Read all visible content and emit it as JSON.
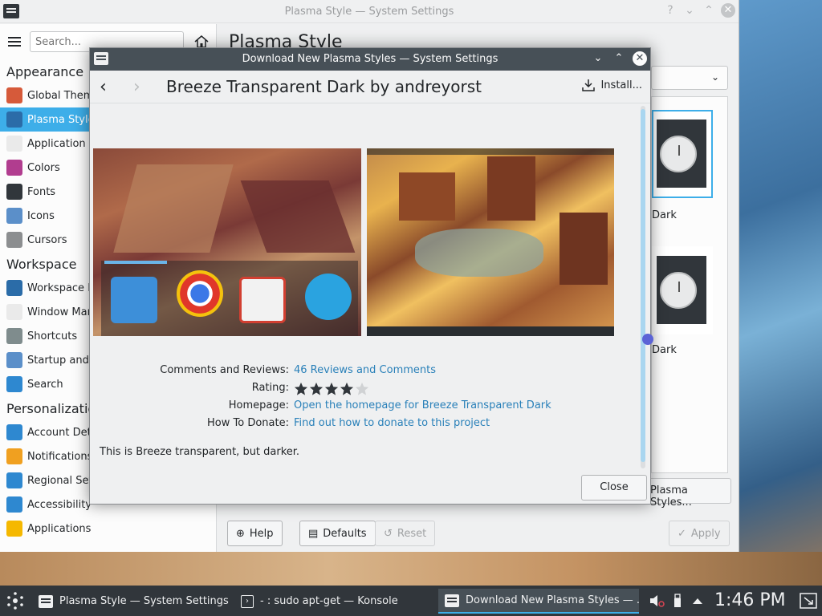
{
  "main_window": {
    "title": "Plasma Style — System Settings",
    "search_placeholder": "Search...",
    "page_title": "Plasma Style",
    "sidebar": {
      "sections": [
        {
          "title": "Appearance",
          "items": [
            {
              "label": "Global Theme",
              "icon": "global-theme-icon",
              "color": "#d65a3a"
            },
            {
              "label": "Plasma Style",
              "icon": "plasma-style-icon",
              "color": "#2b6ca8",
              "selected": true
            },
            {
              "label": "Application Style",
              "icon": "application-style-icon",
              "color": "#eaeaea"
            },
            {
              "label": "Colors",
              "icon": "colors-icon",
              "color": "#b13d8f"
            },
            {
              "label": "Fonts",
              "icon": "fonts-icon",
              "color": "#31363b"
            },
            {
              "label": "Icons",
              "icon": "icons-icon",
              "color": "#5b8fc9"
            },
            {
              "label": "Cursors",
              "icon": "cursors-icon",
              "color": "#8c8e90"
            }
          ]
        },
        {
          "title": "Workspace",
          "items": [
            {
              "label": "Workspace Behavior",
              "icon": "workspace-behavior-icon",
              "color": "#2b6ca8"
            },
            {
              "label": "Window Management",
              "icon": "window-management-icon",
              "color": "#eaeaea"
            },
            {
              "label": "Shortcuts",
              "icon": "shortcuts-icon",
              "color": "#7f8c8d"
            },
            {
              "label": "Startup and Shutdown",
              "icon": "startup-shutdown-icon",
              "color": "#5b8fc9"
            },
            {
              "label": "Search",
              "icon": "search-icon",
              "color": "#2e88d0"
            }
          ]
        },
        {
          "title": "Personalization",
          "items": [
            {
              "label": "Account Details",
              "icon": "account-details-icon",
              "color": "#2e88d0"
            },
            {
              "label": "Notifications",
              "icon": "notifications-icon",
              "color": "#f0a020"
            },
            {
              "label": "Regional Settings",
              "icon": "regional-settings-icon",
              "color": "#2e88d0"
            },
            {
              "label": "Accessibility",
              "icon": "accessibility-icon",
              "color": "#2e88d0"
            },
            {
              "label": "Applications",
              "icon": "applications-icon",
              "color": "#f5b800"
            }
          ]
        }
      ]
    },
    "themes": [
      {
        "name": "Dark",
        "selected": true
      },
      {
        "name": "Dark",
        "selected": false
      }
    ],
    "get_new_label": "Plasma Styles...",
    "buttons": {
      "help": "Help",
      "defaults": "Defaults",
      "reset": "Reset",
      "apply": "Apply"
    }
  },
  "dialog": {
    "title": "Download New Plasma Styles — System Settings",
    "heading": "Breeze Transparent Dark by andreyorst",
    "install_label": "Install...",
    "details": {
      "comments_label": "Comments and Reviews:",
      "comments_value": "46 Reviews and Comments",
      "rating_label": "Rating:",
      "rating_stars": 4,
      "rating_max": 5,
      "homepage_label": "Homepage:",
      "homepage_value": "Open the homepage for Breeze Transparent Dark",
      "donate_label": "How To Donate:",
      "donate_value": "Find out how to donate to this project"
    },
    "description": "This is Breeze transparent, but darker.",
    "close_label": "Close"
  },
  "taskbar": {
    "tasks": [
      {
        "label": "Plasma Style  — System Settings"
      },
      {
        "label": "- : sudo apt-get — Konsole"
      },
      {
        "label": "Download New Plasma Styles — ..."
      }
    ],
    "clock": "1:46 PM"
  },
  "colors": {
    "accent": "#3daee9",
    "link": "#2980b9",
    "titlebar_active": "#475057",
    "taskbar": "#31363b"
  }
}
